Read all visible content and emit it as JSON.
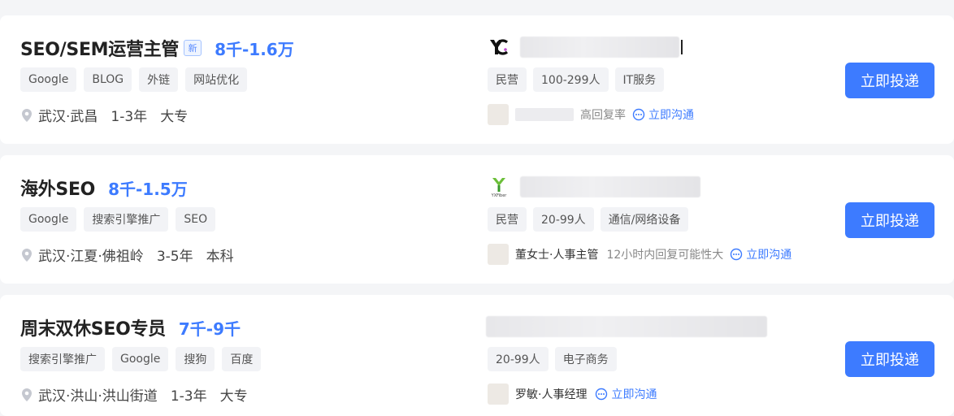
{
  "jobs": [
    {
      "title": "SEO/SEM运营主管",
      "new_badge": "新",
      "salary": "8千-1.6万",
      "tags": [
        "Google",
        "BLOG",
        "外链",
        "网站优化"
      ],
      "location": "武汉·武昌",
      "experience": "1-3年",
      "education": "大专",
      "company_tags": [
        "民营",
        "100-299人",
        "IT服务"
      ],
      "hr_name": "",
      "reply_text": "高回复率",
      "chat_label": "立即沟通",
      "apply_label": "立即投递"
    },
    {
      "title": "海外SEO",
      "salary": "8千-1.5万",
      "tags": [
        "Google",
        "搜索引擎推广",
        "SEO"
      ],
      "location": "武汉·江夏·佛祖岭",
      "experience": "3-5年",
      "education": "本科",
      "company_logo_text": "YXFiber",
      "company_tags": [
        "民营",
        "20-99人",
        "通信/网络设备"
      ],
      "hr_name": "董女士·人事主管",
      "reply_text": "12小时内回复可能性大",
      "chat_label": "立即沟通",
      "apply_label": "立即投递"
    },
    {
      "title": "周末双休SEO专员",
      "salary": "7千-9千",
      "tags": [
        "搜索引擎推广",
        "Google",
        "搜狗",
        "百度"
      ],
      "location": "武汉·洪山·洪山街道",
      "experience": "1-3年",
      "education": "大专",
      "company_tags": [
        "20-99人",
        "电子商务"
      ],
      "hr_name": "罗敏·人事经理",
      "reply_text": "",
      "chat_label": "立即沟通",
      "apply_label": "立即投递"
    }
  ],
  "colors": {
    "accent": "#3d7bff",
    "tag_bg": "#f2f3f6",
    "page_bg": "#f4f5f7"
  }
}
